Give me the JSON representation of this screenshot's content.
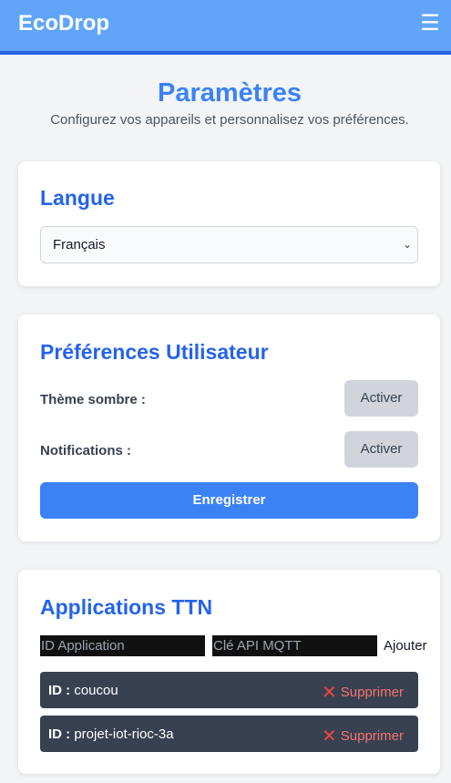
{
  "navbar": {
    "brand": "EcoDrop",
    "menu_icon": "☰"
  },
  "header": {
    "title": "Paramètres",
    "subtitle": "Configurez vos appareils et personnalisez vos préférences."
  },
  "language": {
    "title": "Langue",
    "selected": "Français"
  },
  "preferences": {
    "title": "Préférences Utilisateur",
    "dark_theme_label": "Thème sombre :",
    "dark_theme_button": "Activer",
    "notifications_label": "Notifications :",
    "notifications_button": "Activer",
    "save_label": "Enregistrer"
  },
  "ttn": {
    "title": "Applications TTN",
    "app_id_placeholder": "ID Application",
    "mqtt_key_placeholder": "Clé API MQTT",
    "add_label": "Ajouter",
    "id_prefix": "ID :",
    "delete_label": "Supprimer",
    "apps": [
      {
        "id": "coucou"
      },
      {
        "id": "projet-iot-rioc-3a"
      }
    ]
  },
  "colors": {
    "navbar": "#60a5fa",
    "accent": "#3b82f6",
    "danger": "#f87171",
    "row_bg": "#374151"
  }
}
